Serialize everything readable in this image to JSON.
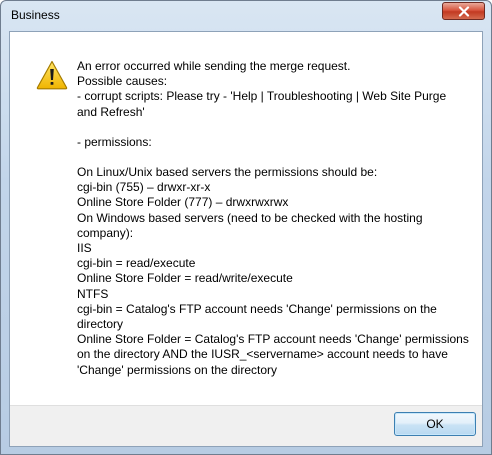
{
  "window": {
    "title": "Business"
  },
  "icons": {
    "dialog_icon": "warning-icon",
    "close": "close-icon"
  },
  "message": {
    "lines": [
      "An error occurred while sending the merge request.",
      "Possible causes:",
      "- corrupt scripts:  Please try - 'Help | Troubleshooting | Web Site Purge and Refresh'",
      "",
      "- permissions:",
      "",
      "On Linux/Unix based servers the permissions should be:",
      "cgi-bin (755) – drwxr-xr-x",
      "Online Store Folder (777) – drwxrwxrwx",
      "On Windows based servers (need to be checked with the hosting company):",
      "IIS",
      "cgi-bin = read/execute",
      "Online Store Folder = read/write/execute",
      "NTFS",
      "cgi-bin = Catalog's FTP account needs 'Change' permissions on the directory",
      "Online Store Folder = Catalog's FTP account needs 'Change' permissions on the directory AND the IUSR_<servername> account needs to have 'Change' permissions on the directory"
    ]
  },
  "buttons": {
    "ok_label": "OK"
  },
  "colors": {
    "close_button": "#c23a22",
    "warning_fill": "#f5c400",
    "dialog_frame": "#c2d5ea"
  }
}
